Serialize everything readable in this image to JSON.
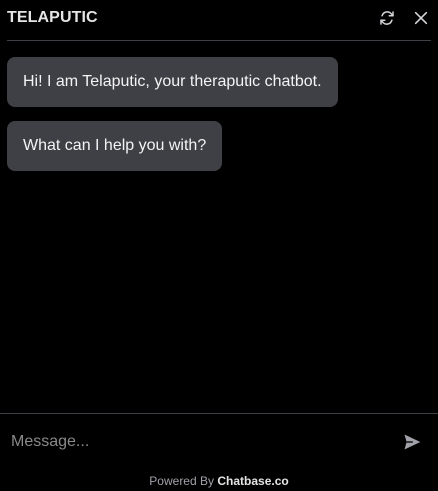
{
  "header": {
    "title": "TELAPUTIC",
    "refresh_icon": "refresh-icon",
    "close_icon": "close-icon"
  },
  "messages": [
    {
      "role": "bot",
      "text": "Hi! I am Telaputic, your theraputic chatbot."
    },
    {
      "role": "bot",
      "text": "What can I help you with?"
    }
  ],
  "composer": {
    "placeholder": "Message...",
    "value": "",
    "send_icon": "send-icon"
  },
  "footer": {
    "prefix": "Powered By",
    "brand": "Chatbase.co"
  },
  "colors": {
    "background": "#000000",
    "bubble": "#3f3f46",
    "divider": "#3f3f46",
    "text": "#f4f4f5"
  }
}
